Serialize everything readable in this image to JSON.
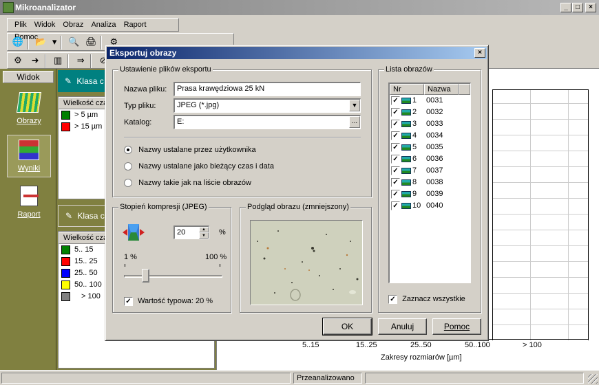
{
  "app": {
    "title": "Mikroanalizator",
    "menu": [
      "Plik",
      "Widok",
      "Obraz",
      "Analiza",
      "Raport",
      "Pomoc"
    ]
  },
  "sidebar": {
    "header": "Widok",
    "items": [
      {
        "label": "Obrazy",
        "icon": "images-icon"
      },
      {
        "label": "Wyniki",
        "icon": "results-icon"
      },
      {
        "label": "Raport",
        "icon": "report-icon"
      }
    ]
  },
  "panels": {
    "top_class": "Klasa c",
    "top_header": "Wielkość cza",
    "top_rows": [
      {
        "color": "#008000",
        "label": "> 5 µm"
      },
      {
        "color": "#ff0000",
        "label": "> 15 µm"
      }
    ],
    "bottom_class": "Klasa c",
    "bottom_header": "Wielkość cza",
    "bottom_rows": [
      {
        "color": "#008000",
        "label": "5.. 15"
      },
      {
        "color": "#ff0000",
        "label": "15.. 25"
      },
      {
        "color": "#0000ff",
        "label": "25.. 50"
      },
      {
        "color": "#ffff00",
        "label": "50.. 100"
      },
      {
        "color": "#808080",
        "label": "> 100"
      }
    ]
  },
  "chart": {
    "x_ticks": [
      "5..15",
      "15..25",
      "25..50",
      "50..100",
      "> 100"
    ],
    "x_label": "Zakresy rozmiarów [µm]"
  },
  "status": {
    "text": "Przeanalizowano"
  },
  "dialog": {
    "title": "Eksportuj obrazy",
    "close": "×",
    "settings_group": "Ustawienie plików eksportu",
    "filename_label": "Nazwa pliku:",
    "filename_value": "Prasa krawędziowa 25 kN",
    "filetype_label": "Typ pliku:",
    "filetype_value": "JPEG (*.jpg)",
    "dir_label": "Katalog:",
    "dir_value": "E:",
    "dir_browse": "...",
    "radio_options": [
      {
        "label": "Nazwy ustalane przez użytkownika",
        "checked": true
      },
      {
        "label": "Nazwy ustalane jako bieżący czas i data",
        "checked": false
      },
      {
        "label": "Nazwy takie jak na liście obrazów",
        "checked": false
      }
    ],
    "compression_group": "Stopień kompresji (JPEG)",
    "compression_value": "20",
    "compression_unit": "%",
    "slider_min": "1 %",
    "slider_max": "100 %",
    "slider_level": 0.2,
    "typical_label": "Wartość typowa: 20 %",
    "typical_checked": true,
    "preview_group": "Podgląd obrazu (zmniejszony)",
    "list_group": "Lista obrazów",
    "list_columns": [
      "Nr",
      "Nazwa"
    ],
    "list_rows": [
      {
        "nr": "1",
        "name": "0031"
      },
      {
        "nr": "2",
        "name": "0032"
      },
      {
        "nr": "3",
        "name": "0033"
      },
      {
        "nr": "4",
        "name": "0034"
      },
      {
        "nr": "5",
        "name": "0035"
      },
      {
        "nr": "6",
        "name": "0036"
      },
      {
        "nr": "7",
        "name": "0037"
      },
      {
        "nr": "8",
        "name": "0038"
      },
      {
        "nr": "9",
        "name": "0039"
      },
      {
        "nr": "10",
        "name": "0040"
      }
    ],
    "select_all_label": "Zaznacz wszystkie",
    "buttons": {
      "ok": "OK",
      "cancel": "Anuluj",
      "help": "Pomoc"
    }
  }
}
